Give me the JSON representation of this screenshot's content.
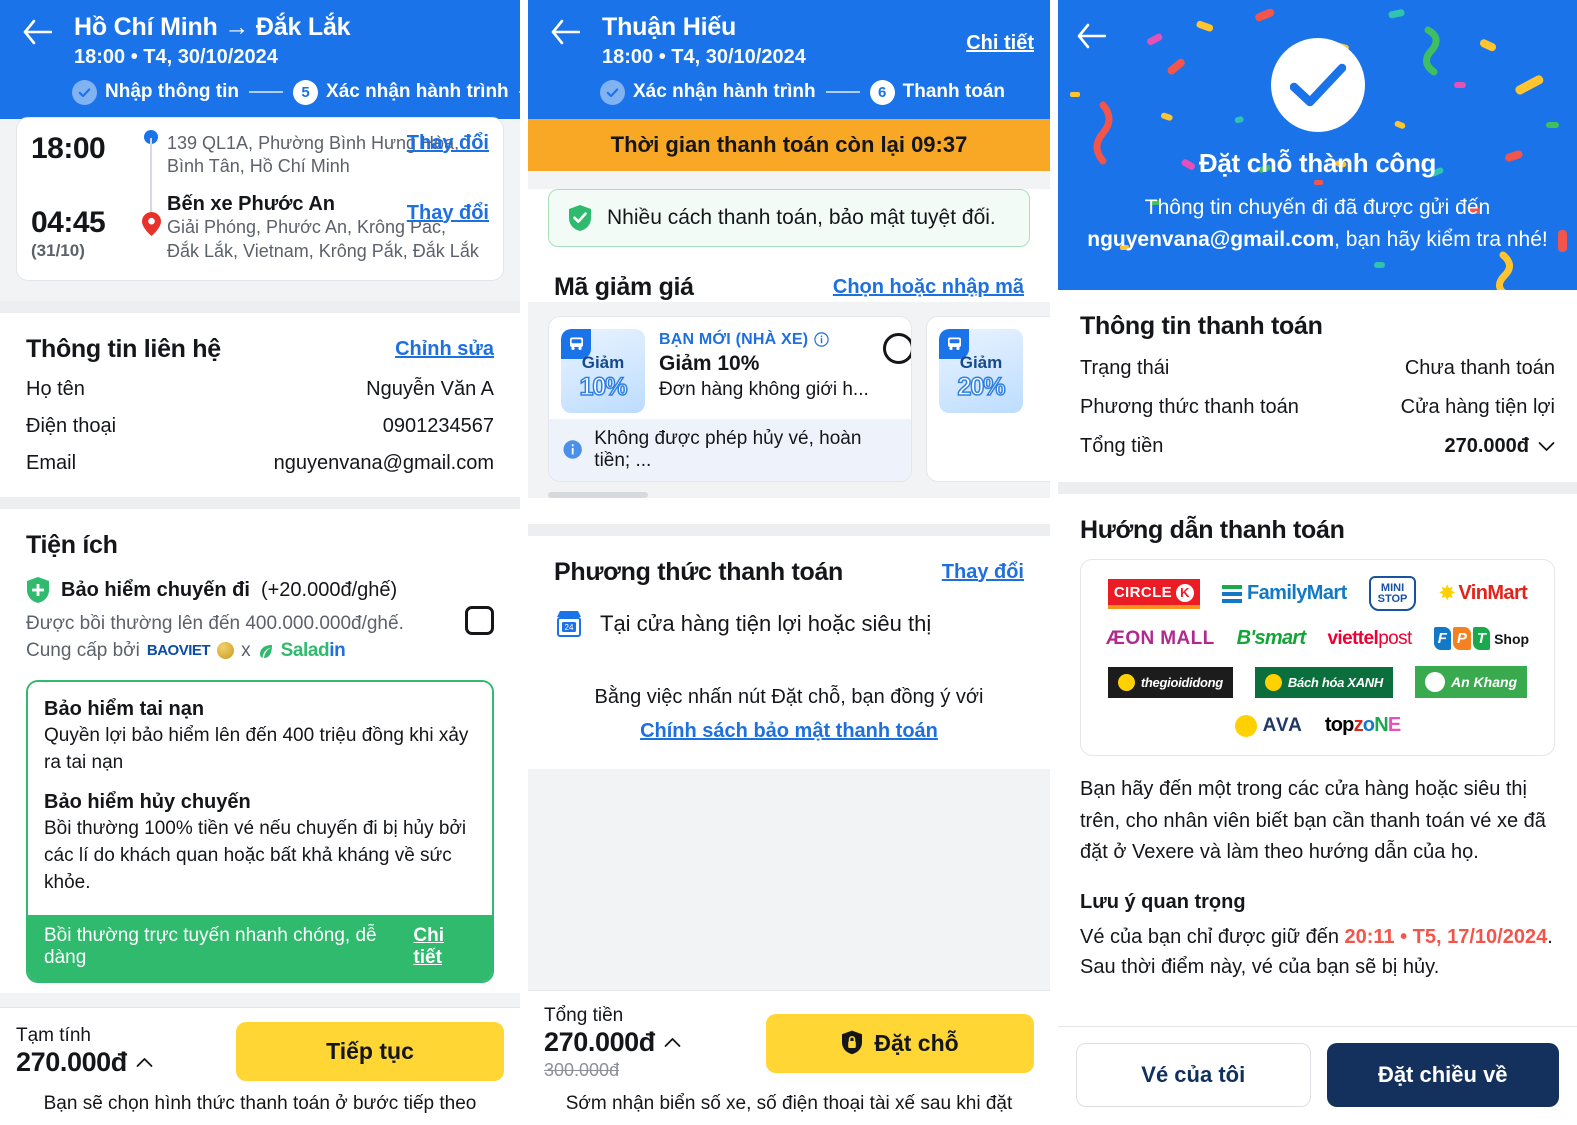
{
  "screen1": {
    "header": {
      "back_icon": "arrow-left-icon",
      "title": "Hồ Chí Minh → Đắk Lắk",
      "subtitle": "18:00 • T4, 30/10/2024",
      "steps": [
        {
          "num": "check",
          "label": "Nhập thông tin",
          "state": "done"
        },
        {
          "num": "5",
          "label": "Xác nhận hành trình",
          "state": "active"
        },
        {
          "num": "6",
          "label": "",
          "state": "upcoming"
        }
      ]
    },
    "route": {
      "depart_time": "18:00",
      "depart_address": "139 QL1A, Phường Bình Hưng Hòa, Bình Tân, Hồ Chí Minh",
      "arrive_time": "04:45",
      "arrive_date": "(31/10)",
      "arrive_name": "Bến xe Phước An",
      "arrive_address": "Giải Phóng, Phước An, Krông Pắc, Đắk Lắk, Vietnam, Krông Pắk, Đắk Lắk",
      "change_label_1": "Thay đổi",
      "change_label_2": "Thay đổi"
    },
    "contact": {
      "title": "Thông tin liên hệ",
      "edit_label": "Chỉnh sửa",
      "rows": [
        {
          "label": "Họ tên",
          "value": "Nguyễn Văn A"
        },
        {
          "label": "Điện thoại",
          "value": "0901234567"
        },
        {
          "label": "Email",
          "value": "nguyenvana@gmail.com"
        }
      ]
    },
    "amenities": {
      "title": "Tiện ích",
      "insurance_name": "Bảo hiểm chuyến đi",
      "insurance_price": "(+20.000đ/ghế)",
      "insurance_desc": "Được bồi thường lên đến 400.000.000đ/ghế.",
      "provider_prefix": "Cung cấp bởi",
      "provider_1": "BAOVIET",
      "provider_sep": "x",
      "provider_2": "Saladin",
      "benefits": [
        {
          "title": "Bảo hiểm tai nạn",
          "desc": "Quyền lợi bảo hiểm lên đến 400 triệu đồng khi xảy ra tai nạn"
        },
        {
          "title": "Bảo hiểm hủy chuyến",
          "desc": "Bồi thường 100% tiền vé nếu chuyến đi bị hủy bởi các lí do khách quan hoặc bất khả kháng về sức khỏe."
        }
      ],
      "footer_text": "Bồi thường trực tuyến nhanh chóng, dễ dàng",
      "footer_link": "Chi tiết"
    },
    "bottom": {
      "label": "Tạm tính",
      "price": "270.000đ",
      "button": "Tiếp tục",
      "note": "Bạn sẽ chọn hình thức thanh toán ở bước tiếp theo"
    }
  },
  "screen2": {
    "header": {
      "back_icon": "arrow-left-icon",
      "title": "Thuận Hiếu",
      "subtitle": "18:00 • T4, 30/10/2024",
      "detail_link": "Chi tiết",
      "steps": [
        {
          "num": "check",
          "label": "Xác nhận hành trình",
          "state": "done"
        },
        {
          "num": "6",
          "label": "Thanh toán",
          "state": "active"
        }
      ]
    },
    "timer": "Thời gian thanh toán còn lại 09:37",
    "safe_note": "Nhiều cách thanh toán, bảo mật tuyệt đối.",
    "voucher": {
      "title": "Mã giảm giá",
      "link": "Chọn hoặc nhập mã",
      "items": [
        {
          "badge_top": "Giảm",
          "badge_bottom": "10%",
          "tag": "BẠN MỚI (NHÀ XE)",
          "title": "Giảm 10%",
          "sub": "Đơn hàng không giới h...",
          "foot": "Không được phép hủy vé, hoàn tiền; ..."
        },
        {
          "badge_top": "Giảm",
          "badge_bottom": "20%",
          "tag": "",
          "title": "",
          "sub": "",
          "foot": ""
        }
      ]
    },
    "payment": {
      "title": "Phương thức thanh toán",
      "change_link": "Thay đổi",
      "method": "Tại cửa hàng tiện lợi hoặc siêu thị",
      "agree_text": "Bằng việc nhấn nút Đặt chỗ, bạn đồng ý với",
      "agree_link": "Chính sách bảo mật thanh toán"
    },
    "bottom": {
      "label": "Tổng tiền",
      "price": "270.000đ",
      "old_price": "300.000đ",
      "button": "Đặt chỗ",
      "note": "Sớm nhận biển số xe, số điện thoại tài xế sau khi đặt"
    }
  },
  "screen3": {
    "back_icon": "arrow-left-icon",
    "success_title": "Đặt chỗ thành công",
    "success_sub_1": "Thông tin chuyến đi đã được gửi đến",
    "success_email": "nguyenvana@gmail.com",
    "success_sub_2": ", bạn hãy kiểm tra nhé!",
    "payment_info": {
      "title": "Thông tin thanh toán",
      "rows": [
        {
          "label": "Trạng thái",
          "value": "Chưa thanh toán",
          "style": "red"
        },
        {
          "label": "Phương thức thanh toán",
          "value": "Cửa hàng tiện lợi",
          "style": "plain"
        },
        {
          "label": "Tổng tiền",
          "value": "270.000đ",
          "style": "bold"
        }
      ]
    },
    "guide": {
      "title": "Hướng dẫn thanh toán",
      "logos": [
        [
          "CIRCLE K",
          "FamilyMart",
          "MINI STOP",
          "VinMart"
        ],
        [
          "ÆON MALL",
          "B'smart",
          "viettel post",
          "FPT Shop"
        ],
        [
          "thegioididong",
          "Bách hóa XANH",
          "An Khang"
        ],
        [
          "AVA",
          "topzone"
        ]
      ],
      "paragraph": "Bạn hãy đến một trong các cửa hàng hoặc siêu thị trên, cho nhân viên biết bạn cần thanh toán vé xe đã đặt ở Vexere và làm theo hướng dẫn của họ.",
      "note_title": "Lưu ý quan trọng",
      "note_prefix": "Vé của bạn chỉ được giữ đến ",
      "note_deadline": "20:11 • T5, 17/10/2024",
      "note_suffix": ". Sau thời điểm này, vé của bạn sẽ bị hủy."
    },
    "bottom": {
      "secondary": "Vé của tôi",
      "primary": "Đặt chiều về"
    }
  },
  "colors": {
    "brand_blue": "#1a73e8",
    "yellow": "#ffd633",
    "green": "#2fba6e",
    "orange": "#f9a825",
    "red": "#f4554a",
    "navy": "#14315e"
  }
}
